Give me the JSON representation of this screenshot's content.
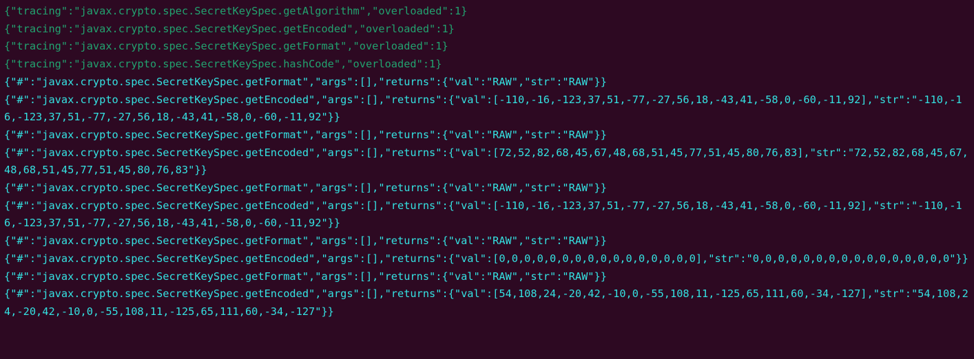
{
  "terminal": {
    "lines": [
      {
        "type": "trace",
        "text": "{\"tracing\":\"javax.crypto.spec.SecretKeySpec.getAlgorithm\",\"overloaded\":1}"
      },
      {
        "type": "trace",
        "text": "{\"tracing\":\"javax.crypto.spec.SecretKeySpec.getEncoded\",\"overloaded\":1}"
      },
      {
        "type": "trace",
        "text": "{\"tracing\":\"javax.crypto.spec.SecretKeySpec.getFormat\",\"overloaded\":1}"
      },
      {
        "type": "trace",
        "text": "{\"tracing\":\"javax.crypto.spec.SecretKeySpec.hashCode\",\"overloaded\":1}"
      },
      {
        "type": "call",
        "text": "{\"#\":\"javax.crypto.spec.SecretKeySpec.getFormat\",\"args\":[],\"returns\":{\"val\":\"RAW\",\"str\":\"RAW\"}}"
      },
      {
        "type": "call",
        "text": "{\"#\":\"javax.crypto.spec.SecretKeySpec.getEncoded\",\"args\":[],\"returns\":{\"val\":[-110,-16,-123,37,51,-77,-27,56,18,-43,41,-58,0,-60,-11,92],\"str\":\"-110,-16,-123,37,51,-77,-27,56,18,-43,41,-58,0,-60,-11,92\"}}"
      },
      {
        "type": "call",
        "text": "{\"#\":\"javax.crypto.spec.SecretKeySpec.getFormat\",\"args\":[],\"returns\":{\"val\":\"RAW\",\"str\":\"RAW\"}}"
      },
      {
        "type": "call",
        "text": "{\"#\":\"javax.crypto.spec.SecretKeySpec.getEncoded\",\"args\":[],\"returns\":{\"val\":[72,52,82,68,45,67,48,68,51,45,77,51,45,80,76,83],\"str\":\"72,52,82,68,45,67,48,68,51,45,77,51,45,80,76,83\"}}"
      },
      {
        "type": "call",
        "text": "{\"#\":\"javax.crypto.spec.SecretKeySpec.getFormat\",\"args\":[],\"returns\":{\"val\":\"RAW\",\"str\":\"RAW\"}}"
      },
      {
        "type": "call",
        "text": "{\"#\":\"javax.crypto.spec.SecretKeySpec.getEncoded\",\"args\":[],\"returns\":{\"val\":[-110,-16,-123,37,51,-77,-27,56,18,-43,41,-58,0,-60,-11,92],\"str\":\"-110,-16,-123,37,51,-77,-27,56,18,-43,41,-58,0,-60,-11,92\"}}"
      },
      {
        "type": "call",
        "text": "{\"#\":\"javax.crypto.spec.SecretKeySpec.getFormat\",\"args\":[],\"returns\":{\"val\":\"RAW\",\"str\":\"RAW\"}}"
      },
      {
        "type": "call",
        "text": "{\"#\":\"javax.crypto.spec.SecretKeySpec.getEncoded\",\"args\":[],\"returns\":{\"val\":[0,0,0,0,0,0,0,0,0,0,0,0,0,0,0,0],\"str\":\"0,0,0,0,0,0,0,0,0,0,0,0,0,0,0,0\"}}"
      },
      {
        "type": "call",
        "text": "{\"#\":\"javax.crypto.spec.SecretKeySpec.getFormat\",\"args\":[],\"returns\":{\"val\":\"RAW\",\"str\":\"RAW\"}}"
      },
      {
        "type": "call",
        "text": "{\"#\":\"javax.crypto.spec.SecretKeySpec.getEncoded\",\"args\":[],\"returns\":{\"val\":[54,108,24,-20,42,-10,0,-55,108,11,-125,65,111,60,-34,-127],\"str\":\"54,108,24,-20,42,-10,0,-55,108,11,-125,65,111,60,-34,-127\"}}"
      }
    ]
  }
}
